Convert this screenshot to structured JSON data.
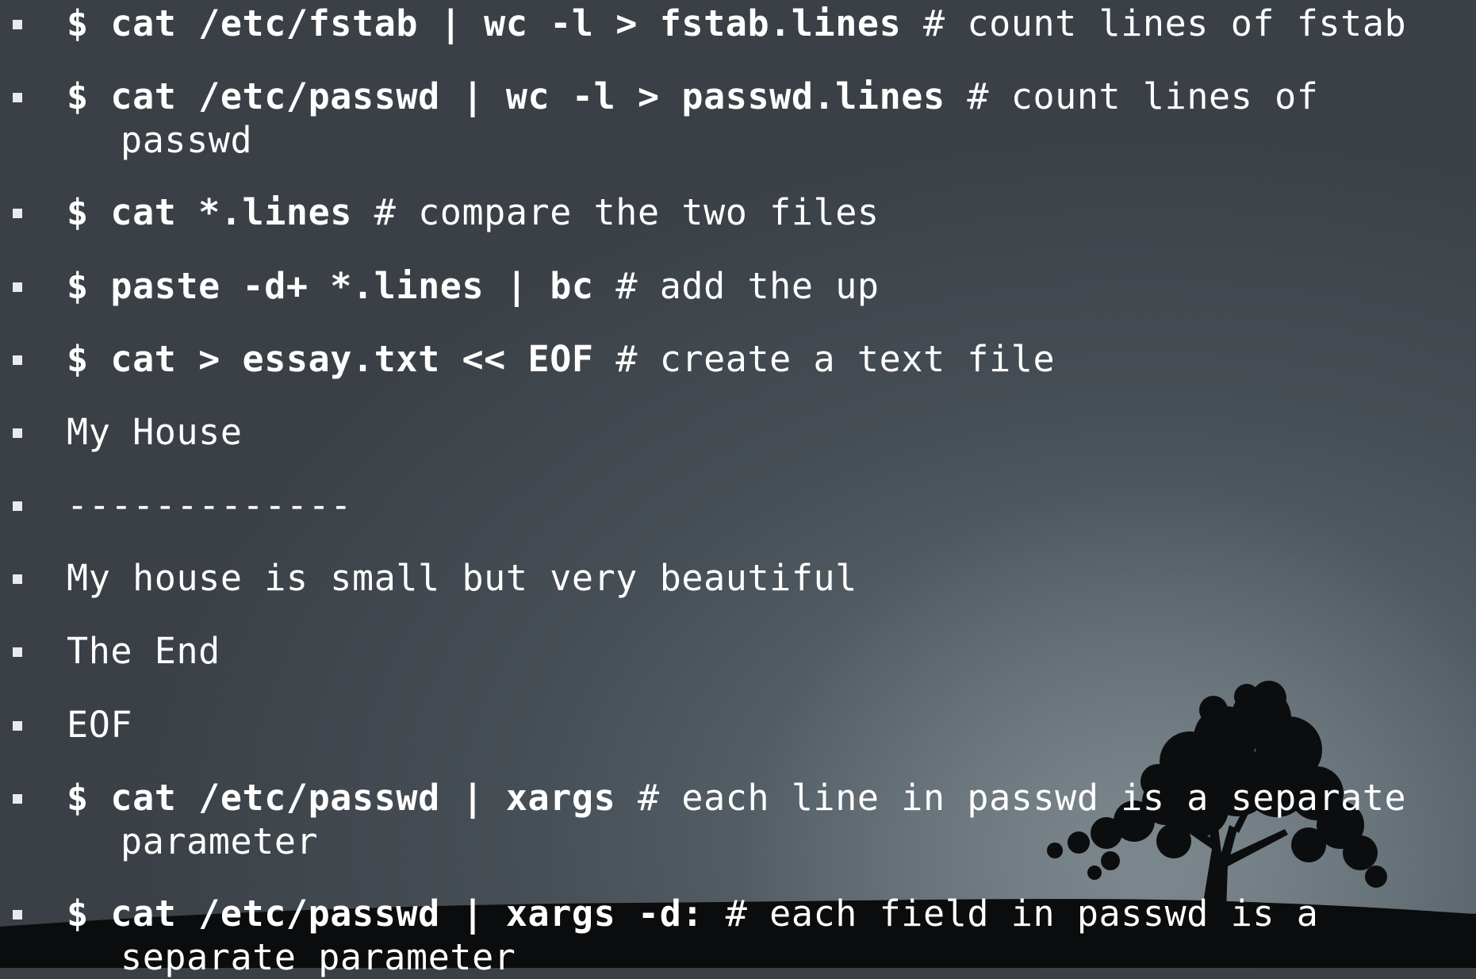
{
  "items": [
    {
      "cmd": "$ cat /etc/fstab | wc -l > fstab.lines",
      "comment": " # count lines of fstab",
      "cont": ""
    },
    {
      "cmd": "$ cat /etc/passwd | wc -l > passwd.lines",
      "comment": " # count lines of",
      "cont": "passwd"
    },
    {
      "cmd": "$ cat *.lines",
      "comment": " # compare the two files",
      "cont": ""
    },
    {
      "cmd": "$ paste -d+ *.lines | bc",
      "comment": " # add the up",
      "cont": ""
    },
    {
      "cmd": "$ cat > essay.txt << EOF",
      "comment": " # create a text file",
      "cont": ""
    },
    {
      "cmd": "",
      "comment": "My House",
      "cont": ""
    },
    {
      "cmd": "",
      "comment": "-------------",
      "cont": ""
    },
    {
      "cmd": "",
      "comment": "My house is small but very beautiful",
      "cont": ""
    },
    {
      "cmd": "",
      "comment": "The End",
      "cont": ""
    },
    {
      "cmd": "",
      "comment": "EOF",
      "cont": ""
    },
    {
      "cmd": "$ cat /etc/passwd | xargs",
      "comment": " # each line in passwd is a separate",
      "cont": "parameter"
    },
    {
      "cmd": "$ cat /etc/passwd | xargs -d:",
      "comment": " # each field in passwd is a",
      "cont": "separate parameter"
    }
  ]
}
